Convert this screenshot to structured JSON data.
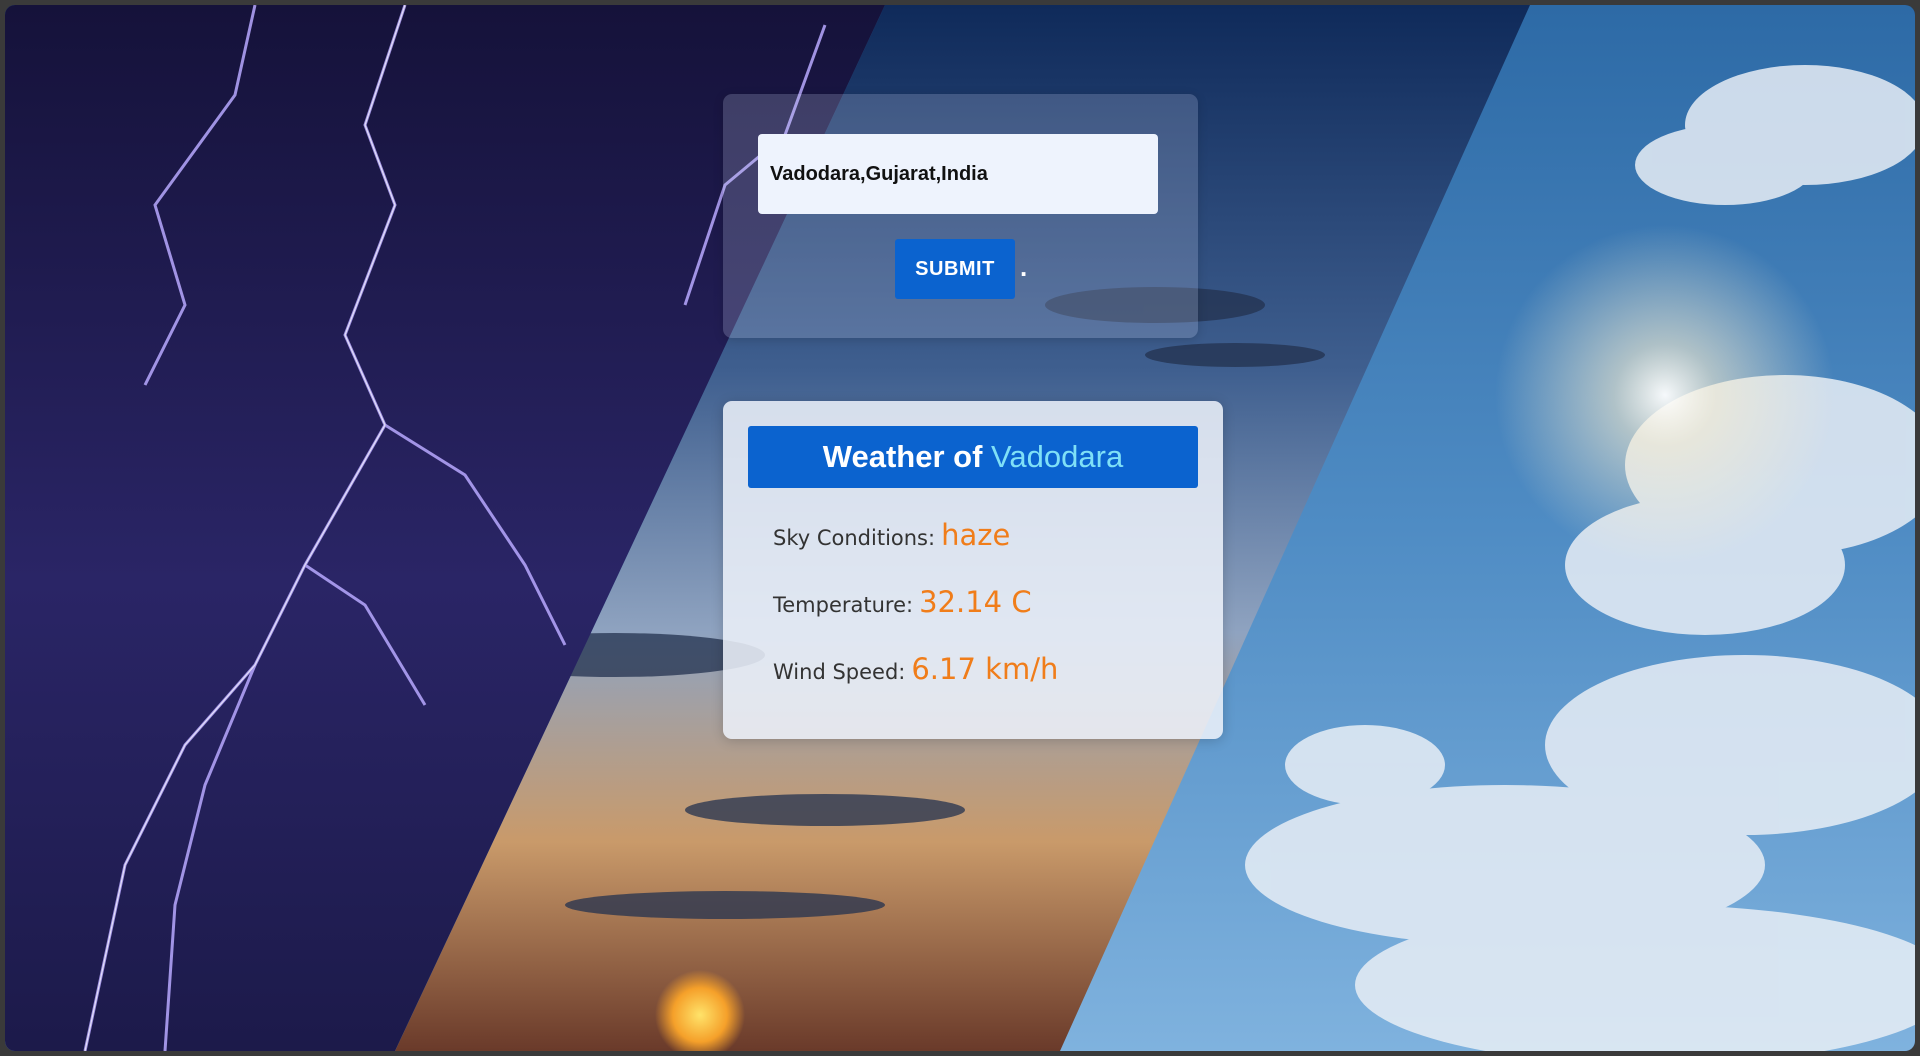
{
  "search": {
    "city_value": "Vadodara,Gujarat,India",
    "submit_label": "SUBMIT",
    "trailing_mark": "."
  },
  "result": {
    "heading_prefix": "Weather of",
    "city": "Vadodara",
    "rows": [
      {
        "label": "Sky Conditions:",
        "value": "haze"
      },
      {
        "label": "Temperature:",
        "value": "32.14 C"
      },
      {
        "label": "Wind Speed:",
        "value": "6.17 km/h"
      }
    ]
  },
  "colors": {
    "accent": "#0b63cf",
    "value_text": "#f07d1a",
    "city_highlight": "#7fe0f7"
  },
  "icons": {
    "background": "weather-collage-background"
  }
}
